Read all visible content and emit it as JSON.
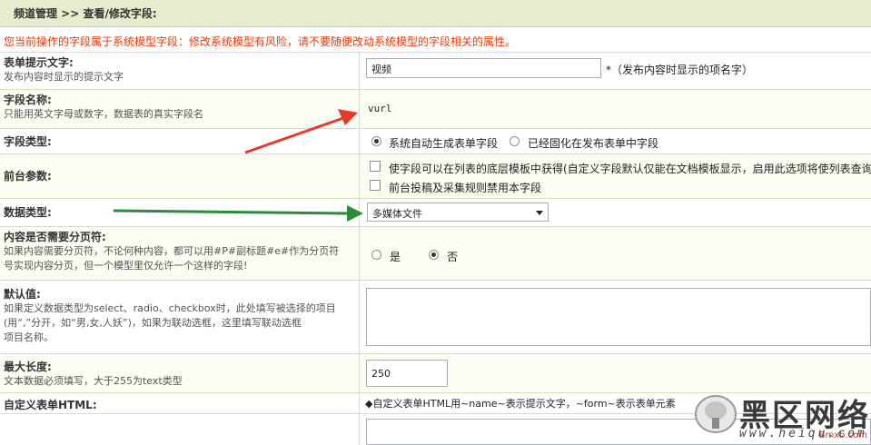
{
  "header": {
    "title": "频道管理 >> 查看/修改字段:"
  },
  "warning": "您当前操作的字段属于系统模型字段：修改系统模型有风险，请不要随便改动系统模型的字段相关的属性。",
  "form": {
    "itemname": {
      "label": "表单提示文字:",
      "desc": "发布内容时显示的提示文字",
      "value": "视频",
      "note": "*（发布内容时显示的项名字）"
    },
    "fieldname": {
      "label": "字段名称:",
      "desc": "只能用英文字母或数字，数据表的真实字段名",
      "value": "vurl"
    },
    "fieldtype": {
      "label": "字段类型:",
      "opt1": "系统自动生成表单字段",
      "opt2": "已经固化在发布表单中字段"
    },
    "frontend": {
      "label": "前台参数:",
      "opt1": "使字段可以在列表的底层模板中获得(自定义字段默认仅能在文档模板显示，启用此选项将使列表查询",
      "opt2": "前台投稿及采集规则禁用本字段"
    },
    "datatype": {
      "label": "数据类型:",
      "selected": "多媒体文件"
    },
    "pagebreak": {
      "label": "内容是否需要分页符:",
      "desc1": "如果内容需要分页符，不论何种内容，都可以用#P#副标题#e#作为分页符",
      "desc2": "号实现内容分页，但一个模型里仅允许一个这样的字段!",
      "yes": "是",
      "no": "否"
    },
    "default": {
      "label": "默认值:",
      "desc1": "如果定义数据类型为select、radio、checkbox时，此处填写被选择的项目",
      "desc2": "(用“,”分开，如“男,女,人妖”)，如果为联动选框，这里填写联动选框",
      "desc3": "项目名称。"
    },
    "maxlength": {
      "label": "最大长度:",
      "desc": "文本数据必须填写，大于255为text类型",
      "value": "250"
    },
    "customhtml": {
      "label": "自定义表单HTML:",
      "note": "◆自定义表单HTML用~name~表示提示文字，~form~表示表单元素"
    }
  },
  "watermark": {
    "text": "黑区网络",
    "url": "www.heiqu.com",
    "small": "Bmxb.com"
  },
  "colors": {
    "header_bg": "#e6eccd",
    "warning": "#e83a0a",
    "arrow_red": "#e53a2a",
    "arrow_green": "#2e8b3a"
  }
}
